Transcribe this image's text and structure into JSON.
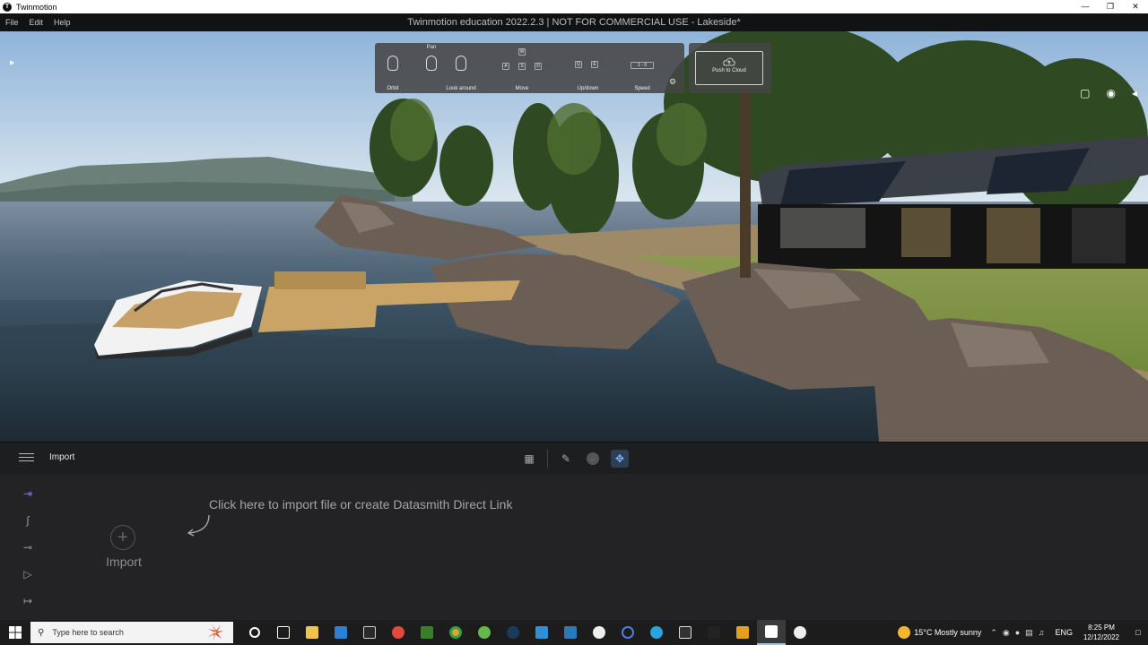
{
  "window": {
    "caption": "Twinmotion",
    "controls": [
      "—",
      "❐",
      "✕"
    ]
  },
  "menu": {
    "items": [
      "File",
      "Edit",
      "Help"
    ],
    "app_title": "Twinmotion education 2022.2.3 | NOT FOR COMMERCIAL USE - Lakeside*"
  },
  "nav": {
    "orbit": "Orbit",
    "pan": "Pan",
    "look_around": "Look around",
    "move": "Move",
    "move_keys": [
      "W",
      "A",
      "S",
      "D"
    ],
    "updown": "Up/down",
    "updown_keys": [
      "Q",
      "E"
    ],
    "speed": "Speed",
    "speed_keys": "1 - 6",
    "push_to_cloud": "Push to Cloud"
  },
  "toolbar": {
    "title": "Import"
  },
  "panel": {
    "hint": "Click here to import file or create Datasmith Direct Link",
    "import_label": "Import"
  },
  "taskbar": {
    "search_placeholder": "Type here to search",
    "weather": "15°C  Mostly sunny",
    "language": "ENG",
    "time": "8:25 PM",
    "date": "12/12/2022"
  },
  "colors": {
    "accent_purple": "#8a6cf0",
    "toolbar_active": "#2d3e57",
    "taskbar_active_line": "#9ec2ea"
  }
}
